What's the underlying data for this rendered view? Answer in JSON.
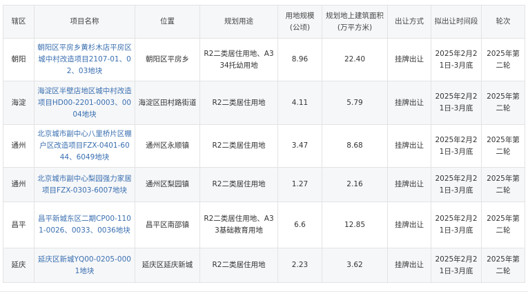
{
  "table": {
    "headers": [
      "辖区",
      "项目名称",
      "位置",
      "规划用途",
      "用地规模(公顷)",
      "规划地上建筑面积(万平方米)",
      "出让方式",
      "拟出让时间段",
      "轮次"
    ],
    "rows": [
      [
        "朝阳",
        "朝阳区平房乡黄杉木店平房区城中村改造项目2107-01、02、03地块",
        "朝阳区平房乡",
        "R2二类居住用地、A334托幼用地",
        "8.96",
        "22.40",
        "挂牌出让",
        "2025年2月21日-3月底",
        "2025年第二轮"
      ],
      [
        "海淀",
        "海淀区半壁店地区城中村改造项目HD00-2201-0003、0004地块",
        "海淀区田村路街道",
        "R2二类居住用地",
        "4.11",
        "5.79",
        "挂牌出让",
        "2025年2月21日-3月底",
        "2025年第二轮"
      ],
      [
        "通州",
        "北京城市副中心八里桥片区棚户区改造项目FZX-0401-6044、6049地块",
        "通州区永顺镇",
        "R2二类居住用地",
        "3.47",
        "8.68",
        "挂牌出让",
        "2025年2月21日-3月底",
        "2025年第二轮"
      ],
      [
        "通州",
        "北京城市副中心梨园强力家居项目FZX-0303-6007地块",
        "通州区梨园镇",
        "R2二类居住用地",
        "1.27",
        "2.16",
        "挂牌出让",
        "2025年2月21日-3月底",
        "2025年第二轮"
      ],
      [
        "昌平",
        "昌平新城东区二期CP00-1101-0026、0033、0036地块",
        "昌平区南邵镇",
        "R2二类居住用地、A33基础教育用地",
        "6.6",
        "12.85",
        "挂牌出让",
        "2025年2月21日-3月底",
        "2025年第二轮"
      ],
      [
        "延庆",
        "延庆区新城YQ00-0205-0001地块",
        "延庆区延庆新城",
        "R2二类居住用地",
        "2.23",
        "3.62",
        "挂牌出让",
        "2025年2月21日-3月底",
        "2025年第二轮"
      ]
    ]
  },
  "colors": {
    "link_text": "#3a6fb0",
    "header_bg": "#f6f7f9",
    "border": "#e3e3e3"
  }
}
